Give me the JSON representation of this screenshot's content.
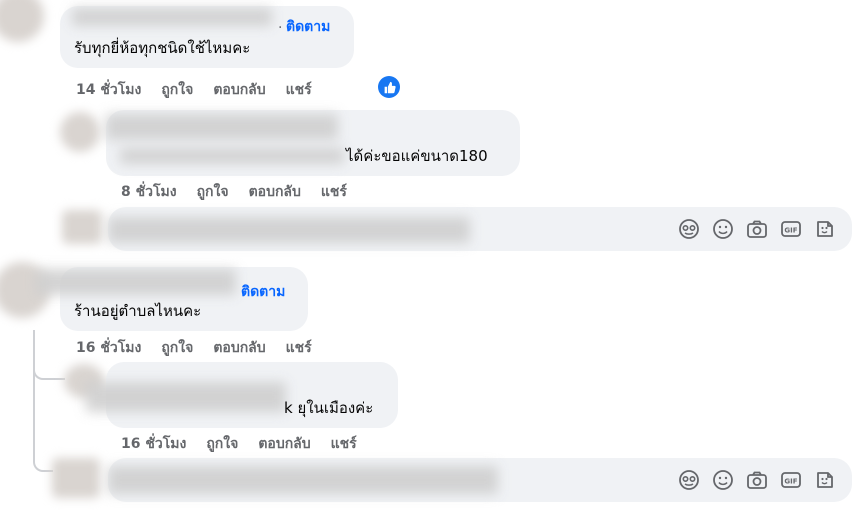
{
  "comments": [
    {
      "follow_label": "ติดตาม",
      "text": "รับทุกยี่ห้อทุกชนิดใช้ไหมคะ",
      "time": "14 ชั่วโมง",
      "like": "ถูกใจ",
      "reply": "ตอบกลับ",
      "share": "แชร์"
    },
    {
      "text": "ได้ค่ะขอแค่ขนาด180",
      "time": "8 ชั่วโมง",
      "like": "ถูกใจ",
      "reply": "ตอบกลับ",
      "share": "แชร์"
    },
    {
      "follow_label": "ติดตาม",
      "text": "ร้านอยู่ตำบลไหนคะ",
      "time": "16 ชั่วโมง",
      "like": "ถูกใจ",
      "reply": "ตอบกลับ",
      "share": "แชร์"
    },
    {
      "text": "k ยุในเมืองค่ะ",
      "time": "16 ชั่วโมง",
      "like": "ถูกใจ",
      "reply": "ตอบกลับ",
      "share": "แชร์"
    }
  ],
  "composer": {
    "icons": [
      "sticker-face-icon",
      "emoji-icon",
      "camera-icon",
      "gif-icon",
      "sticker-icon"
    ],
    "gif_label": "GIF"
  },
  "colors": {
    "link": "#0866ff",
    "meta": "#65676b",
    "bubble": "#f0f2f5",
    "like": "#1877f2"
  }
}
